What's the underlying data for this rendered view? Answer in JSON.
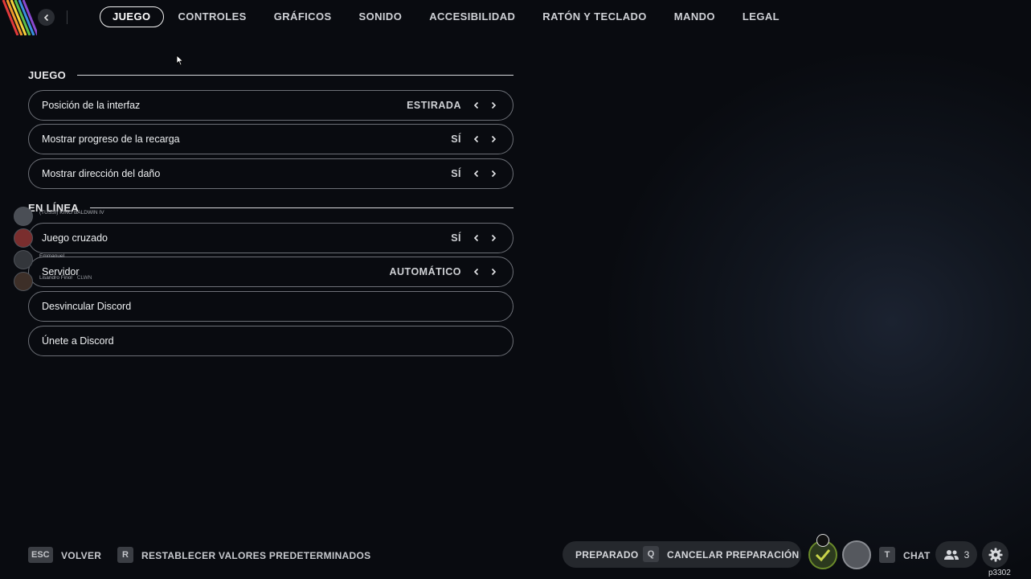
{
  "tabs": [
    "JUEGO",
    "CONTROLES",
    "GRÁFICOS",
    "SONIDO",
    "ACCESIBILIDAD",
    "RATÓN Y TECLADO",
    "MANDO",
    "LEGAL"
  ],
  "active_tab": "JUEGO",
  "sections": {
    "juego": {
      "title": "JUEGO",
      "rows": [
        {
          "label": "Posición de la interfaz",
          "value": "ESTIRADA"
        },
        {
          "label": "Mostrar progreso de la recarga",
          "value": "SÍ"
        },
        {
          "label": "Mostrar dirección del daño",
          "value": "SÍ"
        }
      ]
    },
    "en_linea": {
      "title": "EN LÍNEA",
      "rows": [
        {
          "label": "Juego cruzado",
          "value": "SÍ"
        },
        {
          "label": "Servidor",
          "value": "AUTOMÁTICO"
        },
        {
          "label": "Desvincular Discord"
        },
        {
          "label": "Únete a Discord"
        }
      ]
    }
  },
  "friends": [
    {
      "name": "(TUSSI) KING BALDWIN IV"
    },
    {
      "name": ""
    },
    {
      "name": "Emmanuel"
    },
    {
      "name": "Lisandro Finol",
      "tag": "CLWN"
    }
  ],
  "bottom": {
    "back_key": "ESC",
    "back_label": "VOLVER",
    "reset_key": "R",
    "reset_label": "RESTABLECER VALORES PREDETERMINADOS",
    "ready_label": "PREPARADO",
    "cancel_key": "Q",
    "cancel_label": "CANCELAR PREPARACIÓN",
    "chat_key": "T",
    "chat_label": "CHAT",
    "party_count": "3",
    "version": "p3302"
  },
  "colors": {
    "background": "#090b10",
    "row_border": "#6d7077",
    "accent_green": "#6a8a2a",
    "logo_stripes": [
      "#e23a3a",
      "#f19a2c",
      "#f4d33a",
      "#5bbf4a",
      "#3a8ee0",
      "#8a4ad0"
    ]
  },
  "icons": [
    "back-arrow-icon",
    "chevron-left-icon",
    "chevron-right-icon",
    "users-icon",
    "gear-icon",
    "mouse-cursor-icon"
  ]
}
